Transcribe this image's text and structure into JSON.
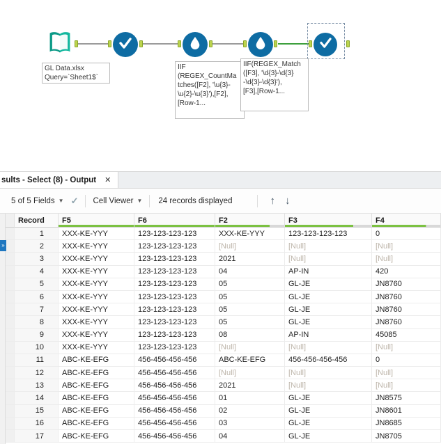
{
  "canvas": {
    "input_tool": {
      "annotation": "GL Data.xlsx\nQuery=`Sheet1$`"
    },
    "formula_tool_1": {
      "annotation": "IIF\n(REGEX_CountMa\ntches([F2], '\\u{3}-\n\\u{2}-\\u{3}'),[F2],\n[Row-1..."
    },
    "formula_tool_2": {
      "annotation": "IIF(REGEX_Match\n([F3], '\\d{3}-\\d{3}\n-\\d{3}-\\d{3}'),\n[F3],[Row-1..."
    }
  },
  "results": {
    "tab": {
      "label": "sults - Select (8) - Output",
      "close_label": "✕"
    },
    "toolbar": {
      "fields_dropdown": "5 of 5 Fields",
      "check_icon": "✓",
      "cell_viewer_dropdown": "Cell Viewer",
      "records_displayed": "24 records displayed",
      "up_arrow": "↑",
      "down_arrow": "↓",
      "caret": "▼"
    },
    "grid": {
      "columns": [
        {
          "label": "Record"
        },
        {
          "label": "F5"
        },
        {
          "label": "F6"
        },
        {
          "label": "F2"
        },
        {
          "label": "F3"
        },
        {
          "label": "F4"
        }
      ],
      "rows": [
        {
          "n": "1",
          "f5": "XXX-KE-YYY",
          "f6": "123-123-123-123",
          "f2": "XXX-KE-YYY",
          "f3": "123-123-123-123",
          "f4": "0"
        },
        {
          "n": "2",
          "f5": "XXX-KE-YYY",
          "f6": "123-123-123-123",
          "f2": "[Null]",
          "f3": "[Null]",
          "f4": "[Null]"
        },
        {
          "n": "3",
          "f5": "XXX-KE-YYY",
          "f6": "123-123-123-123",
          "f2": "2021",
          "f3": "[Null]",
          "f4": "[Null]"
        },
        {
          "n": "4",
          "f5": "XXX-KE-YYY",
          "f6": "123-123-123-123",
          "f2": "04",
          "f3": "AP-IN",
          "f4": "420"
        },
        {
          "n": "5",
          "f5": "XXX-KE-YYY",
          "f6": "123-123-123-123",
          "f2": "05",
          "f3": "GL-JE",
          "f4": "JN8760"
        },
        {
          "n": "6",
          "f5": "XXX-KE-YYY",
          "f6": "123-123-123-123",
          "f2": "05",
          "f3": "GL-JE",
          "f4": "JN8760"
        },
        {
          "n": "7",
          "f5": "XXX-KE-YYY",
          "f6": "123-123-123-123",
          "f2": "05",
          "f3": "GL-JE",
          "f4": "JN8760"
        },
        {
          "n": "8",
          "f5": "XXX-KE-YYY",
          "f6": "123-123-123-123",
          "f2": "05",
          "f3": "GL-JE",
          "f4": "JN8760"
        },
        {
          "n": "9",
          "f5": "XXX-KE-YYY",
          "f6": "123-123-123-123",
          "f2": "08",
          "f3": "AP-IN",
          "f4": "45085"
        },
        {
          "n": "10",
          "f5": "XXX-KE-YYY",
          "f6": "123-123-123-123",
          "f2": "[Null]",
          "f3": "[Null]",
          "f4": "[Null]"
        },
        {
          "n": "11",
          "f5": "ABC-KE-EFG",
          "f6": "456-456-456-456",
          "f2": "ABC-KE-EFG",
          "f3": "456-456-456-456",
          "f4": "0"
        },
        {
          "n": "12",
          "f5": "ABC-KE-EFG",
          "f6": "456-456-456-456",
          "f2": "[Null]",
          "f3": "[Null]",
          "f4": "[Null]"
        },
        {
          "n": "13",
          "f5": "ABC-KE-EFG",
          "f6": "456-456-456-456",
          "f2": "2021",
          "f3": "[Null]",
          "f4": "[Null]"
        },
        {
          "n": "14",
          "f5": "ABC-KE-EFG",
          "f6": "456-456-456-456",
          "f2": "01",
          "f3": "GL-JE",
          "f4": "JN8575"
        },
        {
          "n": "15",
          "f5": "ABC-KE-EFG",
          "f6": "456-456-456-456",
          "f2": "02",
          "f3": "GL-JE",
          "f4": "JN8601"
        },
        {
          "n": "16",
          "f5": "ABC-KE-EFG",
          "f6": "456-456-456-456",
          "f2": "03",
          "f3": "GL-JE",
          "f4": "JN8685"
        },
        {
          "n": "17",
          "f5": "ABC-KE-EFG",
          "f6": "456-456-456-456",
          "f2": "04",
          "f3": "GL-JE",
          "f4": "JN8705"
        }
      ]
    }
  }
}
